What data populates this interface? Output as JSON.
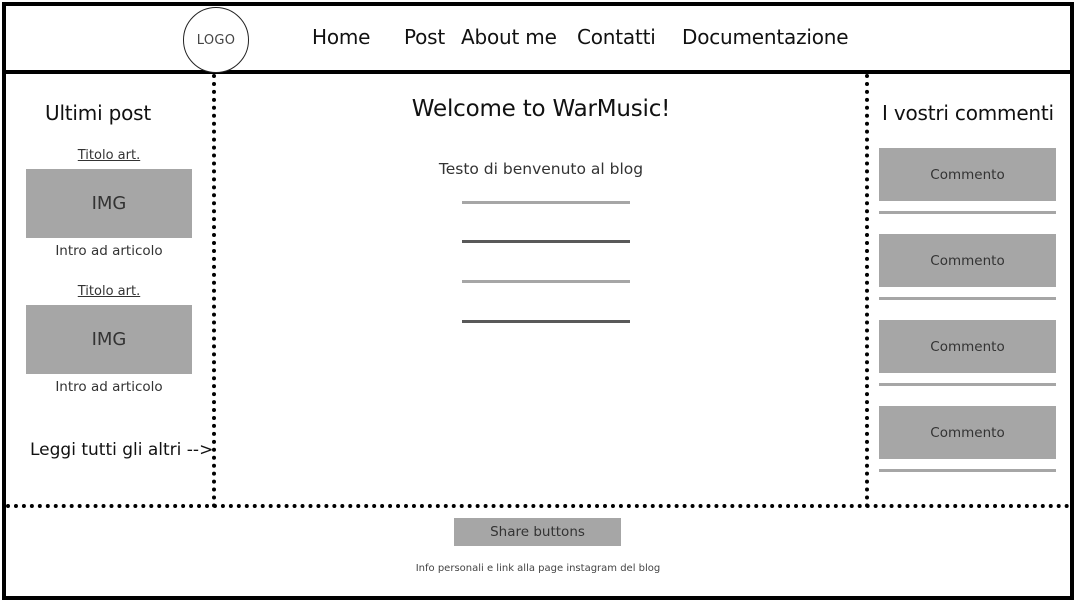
{
  "header": {
    "logo_label": "LOGO",
    "nav": [
      {
        "label": "Home"
      },
      {
        "label": "Post"
      },
      {
        "label": "About me"
      },
      {
        "label": "Contatti"
      },
      {
        "label": "Documentazione"
      }
    ]
  },
  "left_sidebar": {
    "title": "Ultimi post",
    "posts": [
      {
        "title": "Titolo art.",
        "image_label": "IMG",
        "intro": "Intro ad articolo"
      },
      {
        "title": "Titolo art.",
        "image_label": "IMG",
        "intro": "Intro ad articolo"
      }
    ],
    "read_all_link": "Leggi tutti gli altri -->"
  },
  "main": {
    "title": "Welcome to WarMusic!",
    "welcome_text": "Testo di benvenuto al blog",
    "placeholder_lines": [
      {
        "shade": "light",
        "color": "#a6a6a6"
      },
      {
        "shade": "dark",
        "color": "#595959"
      },
      {
        "shade": "light",
        "color": "#a6a6a6"
      },
      {
        "shade": "dark",
        "color": "#595959"
      }
    ]
  },
  "right_sidebar": {
    "title": "I vostri commenti",
    "comments": [
      {
        "label": "Commento"
      },
      {
        "label": "Commento"
      },
      {
        "label": "Commento"
      },
      {
        "label": "Commento"
      }
    ]
  },
  "footer": {
    "share_button": "Share buttons",
    "info": "Info personali e link alla page instagram del blog"
  },
  "colors": {
    "border": "#000000",
    "placeholder_gray": "#a6a6a6",
    "dark_gray": "#595959"
  }
}
